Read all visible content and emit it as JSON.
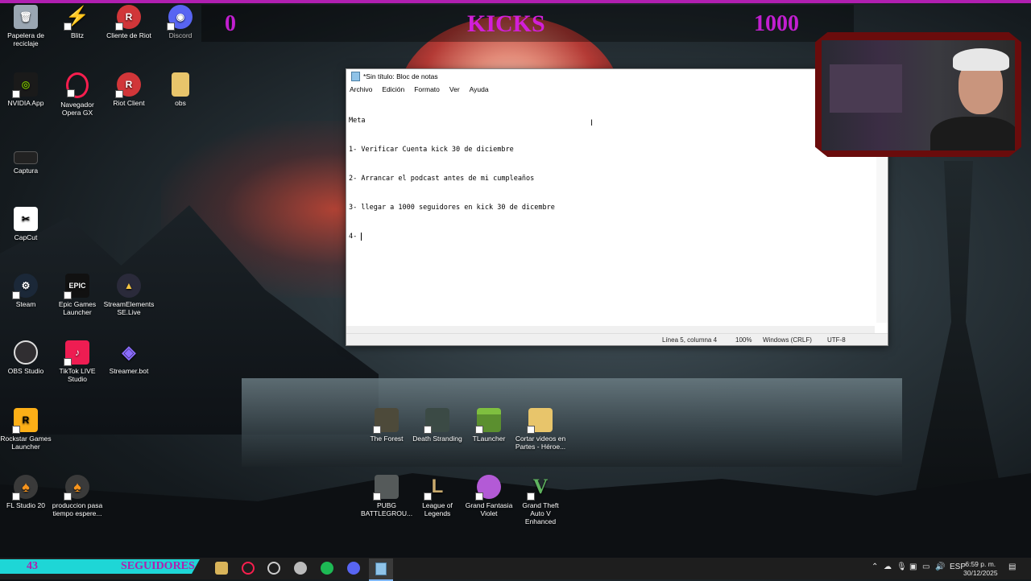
{
  "overlay": {
    "left_value": "0",
    "title": "KICKS",
    "right_value": "1000"
  },
  "desktop_icons": [
    {
      "label": "Papelera de reciclaje",
      "icon": "recycle-bin-icon",
      "color": "#9aa6b2"
    },
    {
      "label": "Blitz",
      "icon": "blitz-icon",
      "color": "#e0302a"
    },
    {
      "label": "Cliente de Riot",
      "icon": "riot-icon",
      "color": "#d13639"
    },
    {
      "label": "Discord",
      "icon": "discord-icon",
      "color": "#5865f2"
    },
    {
      "label": "NVIDIA App",
      "icon": "nvidia-icon",
      "color": "#76b900"
    },
    {
      "label": "Navegador Opera GX",
      "icon": "opera-gx-icon",
      "color": "#fa1e4e"
    },
    {
      "label": "Riot Client",
      "icon": "riot-icon",
      "color": "#d13639"
    },
    {
      "label": "obs",
      "icon": "folder-icon",
      "color": "#e8c56b"
    },
    {
      "label": "Captura",
      "icon": "capture-icon",
      "color": "#222222"
    },
    {
      "label": "CapCut",
      "icon": "capcut-icon",
      "color": "#ffffff"
    },
    {
      "label": "Steam",
      "icon": "steam-icon",
      "color": "#1b2838"
    },
    {
      "label": "Epic Games Launcher",
      "icon": "epic-icon",
      "color": "#111111"
    },
    {
      "label": "StreamElements SE.Live",
      "icon": "streamelements-icon",
      "color": "#2a2a3a"
    },
    {
      "label": "OBS Studio",
      "icon": "obs-icon",
      "color": "#302e31"
    },
    {
      "label": "TikTok LIVE Studio",
      "icon": "tiktok-icon",
      "color": "#ee1d52"
    },
    {
      "label": "Streamer.bot",
      "icon": "streamerbot-icon",
      "color": "#5b3fd6"
    },
    {
      "label": "Rockstar Games Launcher",
      "icon": "rockstar-icon",
      "color": "#fcaf17"
    },
    {
      "label": "FL Studio 20",
      "icon": "fl-studio-icon",
      "color": "#f7941d"
    },
    {
      "label": "produccion pasa tiempo espere...",
      "icon": "fl-studio-icon",
      "color": "#f7941d"
    },
    {
      "label": "The Forest",
      "icon": "the-forest-icon",
      "color": "#4d4a3a"
    },
    {
      "label": "Death Stranding",
      "icon": "death-stranding-icon",
      "color": "#3b4a45"
    },
    {
      "label": "TLauncher",
      "icon": "minecraft-icon",
      "color": "#5b8f2f"
    },
    {
      "label": "Cortar videos en Partes - Héroe...",
      "icon": "folder-icon",
      "color": "#e8c56b"
    },
    {
      "label": "PUBG BATTLEGROU...",
      "icon": "pubg-icon",
      "color": "#555a5a"
    },
    {
      "label": "League of Legends",
      "icon": "league-icon",
      "color": "#c8aa6e"
    },
    {
      "label": "Grand Fantasia Violet",
      "icon": "grand-fantasia-icon",
      "color": "#b35ad6"
    },
    {
      "label": "Grand Theft Auto V Enhanced",
      "icon": "gta-icon",
      "color": "#2b2b2b"
    }
  ],
  "notepad": {
    "title": "*Sin título: Bloc de notas",
    "menu": [
      "Archivo",
      "Edición",
      "Formato",
      "Ver",
      "Ayuda"
    ],
    "lines": [
      "Meta",
      "1- Verificar Cuenta kick 30 de diciembre",
      "2- Arrancar el podcast antes de mi cumpleaños",
      "3- llegar a 1000 seguidores en kick 30 de dicembre",
      "4- "
    ],
    "status": {
      "position": "Línea 5, columna 4",
      "zoom": "100%",
      "eol": "Windows (CRLF)",
      "encoding": "UTF-8"
    }
  },
  "taskbar": {
    "left_count": "43",
    "left_label": "SEGUIDORES",
    "tray_language": "ESP",
    "time": "6:59 p. m.",
    "date": "30/12/2025"
  }
}
